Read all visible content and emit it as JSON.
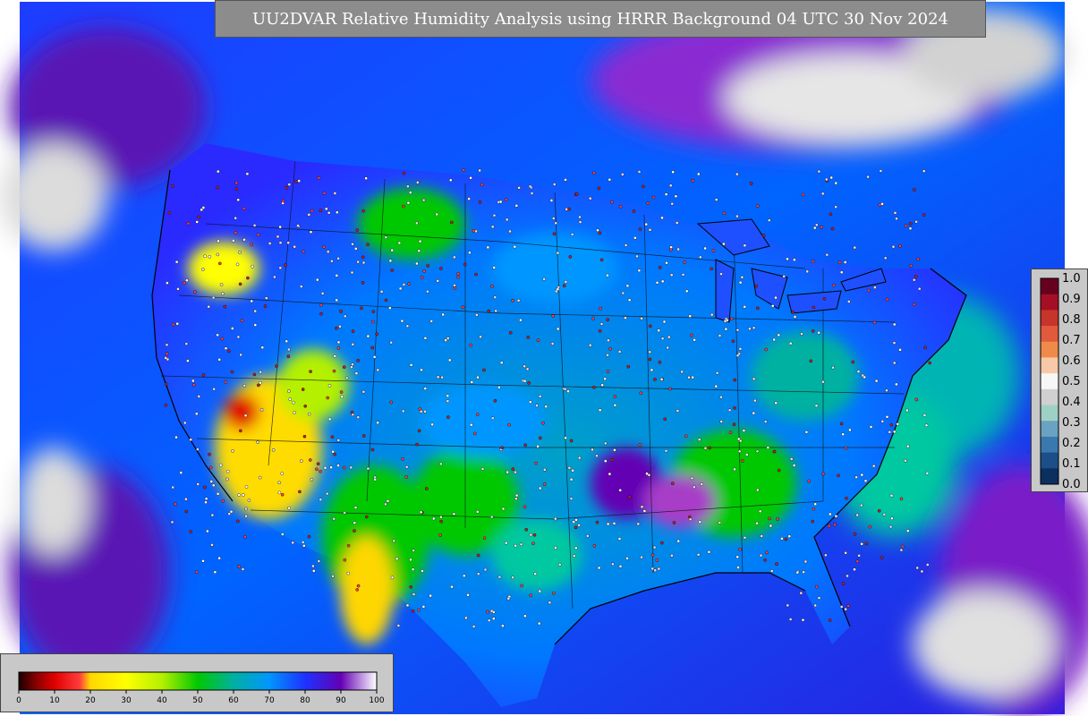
{
  "title": "UU2DVAR Relative Humidity Analysis using HRRR Background 04 UTC 30 Nov 2024",
  "map": {
    "region": "CONUS",
    "variable": "Relative Humidity (%)",
    "station_markers": true
  },
  "legend_rh": {
    "ticks": [
      "0",
      "10",
      "20",
      "30",
      "40",
      "50",
      "60",
      "70",
      "80",
      "90",
      "100"
    ],
    "colors": {
      "0": "#1a0000",
      "5": "#8b0000",
      "10": "#e00000",
      "17": "#ff3c3c",
      "20": "#ffd700",
      "30": "#ffff00",
      "40": "#b4f000",
      "50": "#00c800",
      "60": "#00b0a0",
      "70": "#0096ff",
      "80": "#1e32ff",
      "90": "#6400b4",
      "100": "#ffffff"
    }
  },
  "legend_uncertainty": {
    "ticks": [
      "1.0",
      "0.9",
      "0.8",
      "0.7",
      "0.6",
      "0.5",
      "0.4",
      "0.3",
      "0.2",
      "0.1",
      "0.0"
    ],
    "colors": [
      "#67001f",
      "#a50f25",
      "#c7342a",
      "#e05a3b",
      "#f08a4a",
      "#f8c9a9",
      "#f7f7f7",
      "#d0d0d0",
      "#9fd0c5",
      "#6aa3c2",
      "#3a79ad",
      "#1c4f88",
      "#0b2f5e"
    ]
  }
}
